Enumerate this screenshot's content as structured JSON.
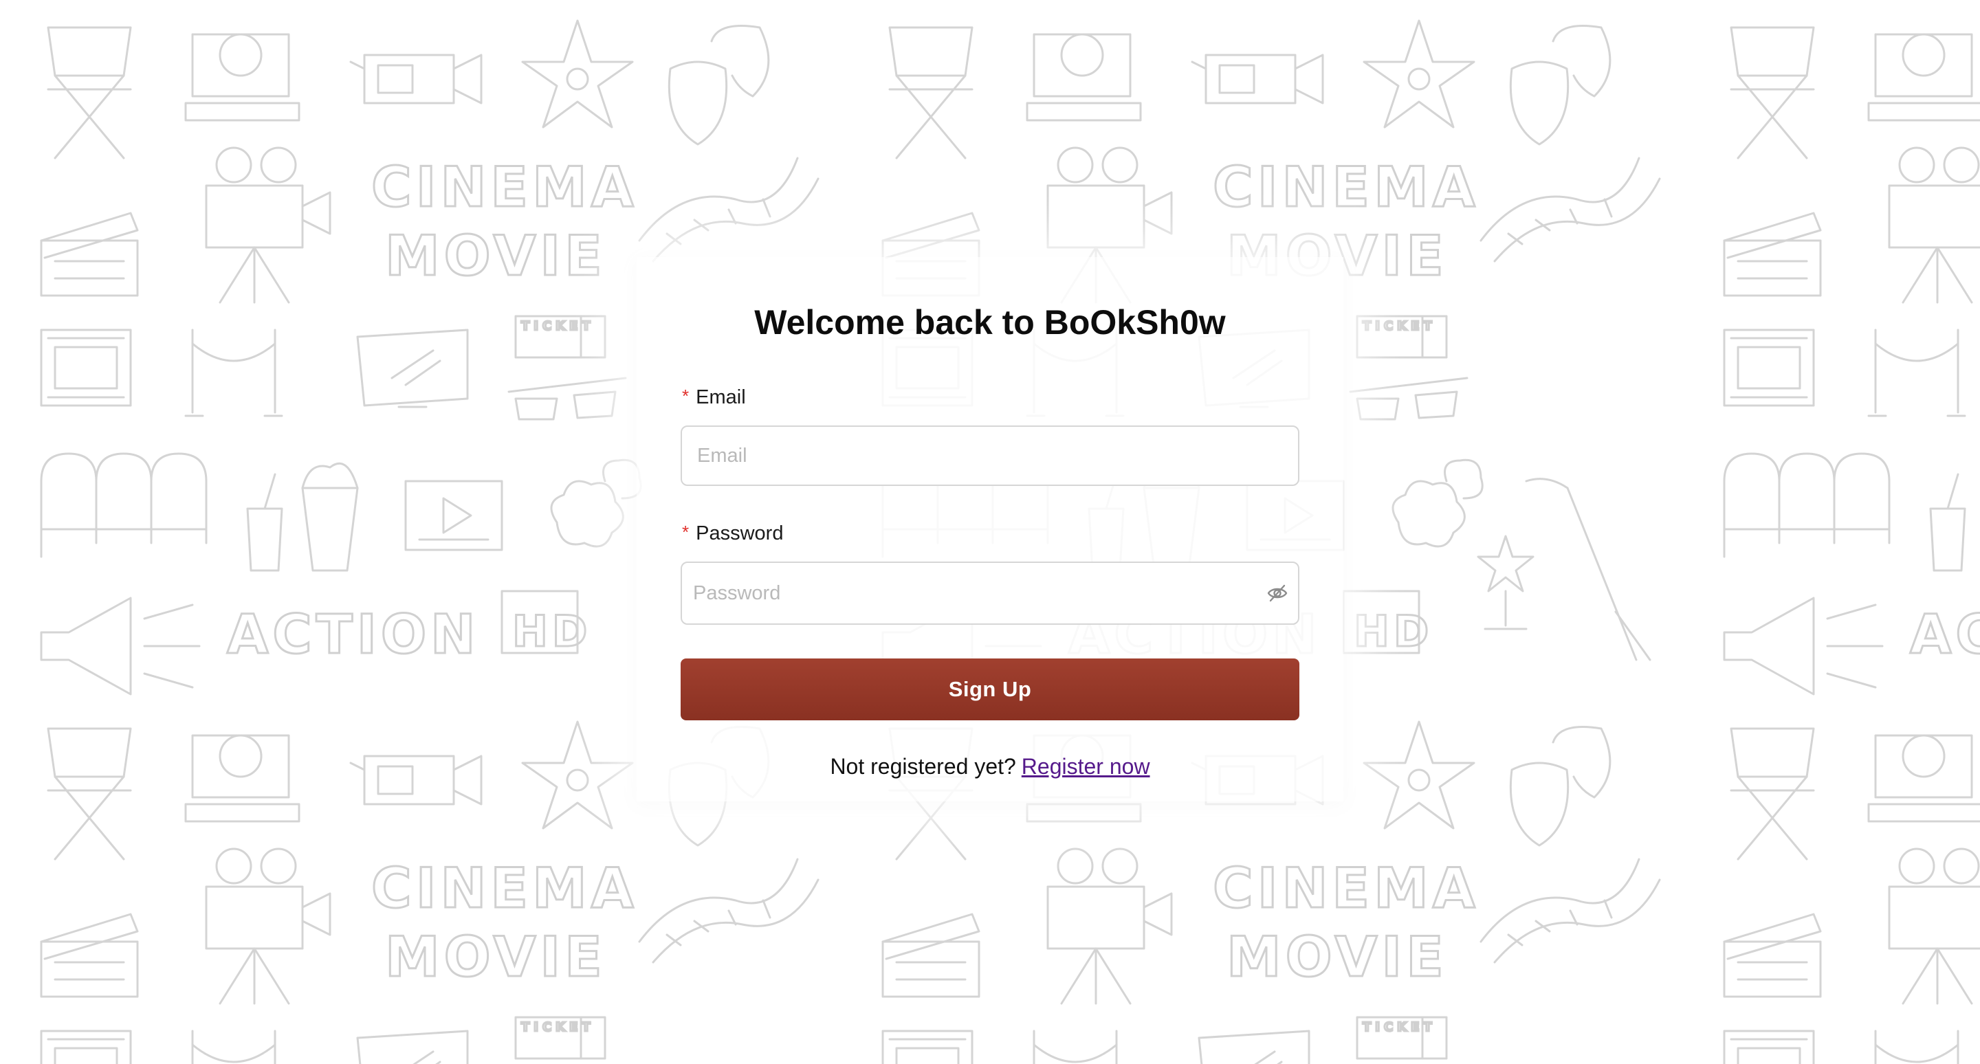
{
  "colors": {
    "primary_button": "#953826",
    "required_marker": "#e0302c",
    "link": "#551a8b",
    "doodle_stroke": "#d4d4d4"
  },
  "background": {
    "words": [
      "CINEMA",
      "MOVIE",
      "ACTION",
      "HD",
      "TICKET"
    ]
  },
  "login": {
    "title": "Welcome back to BoOkSh0w",
    "email": {
      "required_mark": "*",
      "label": "Email",
      "placeholder": "Email",
      "value": ""
    },
    "password": {
      "required_mark": "*",
      "label": "Password",
      "placeholder": "Password",
      "value": "",
      "toggle_icon": "eye-invisible-icon"
    },
    "submit_label": "Sign Up",
    "footer_text": "Not registered yet?",
    "register_link": "Register now"
  }
}
